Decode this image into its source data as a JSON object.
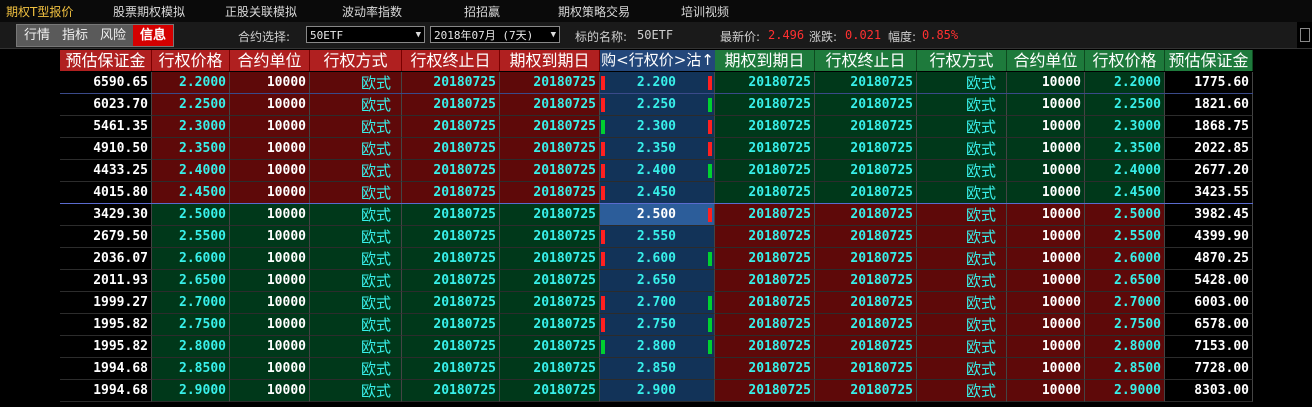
{
  "menu": [
    "期权T型报价",
    "股票期权模拟",
    "正股关联模拟",
    "波动率指数",
    "招招赢",
    "期权策略交易",
    "培训视频"
  ],
  "tabs": [
    {
      "label": "行情",
      "active": false
    },
    {
      "label": "指标",
      "active": false
    },
    {
      "label": "风险",
      "active": false
    },
    {
      "label": "信息",
      "active": true
    }
  ],
  "toolbar": {
    "contract_label": "合约选择:",
    "contract_value": "50ETF",
    "month_value": "2018年07月 (7天)",
    "underlying_label": "标的名称:",
    "underlying_value": "50ETF",
    "last_label": "最新价:",
    "last_value": "2.496",
    "change_label": "涨跌:",
    "change_value": "0.021",
    "pct_label": "幅度:",
    "pct_value": "0.85%"
  },
  "colors": {
    "call": "#b02020",
    "put": "#1e7a3c",
    "mid": "#23477a",
    "cyan": "#38f0ea",
    "up": "#ff3030"
  },
  "headers": {
    "call": [
      "预估保证金",
      "行权价格",
      "合约单位",
      "行权方式",
      "行权终止日",
      "期权到期日"
    ],
    "mid": "购<行权价>沽↑",
    "put": [
      "期权到期日",
      "行权终止日",
      "行权方式",
      "合约单位",
      "行权价格",
      "预估保证金"
    ]
  },
  "rows": [
    {
      "call_margin": "6590.65",
      "strike_call": "2.2000",
      "unit_call": "10000",
      "style_call": "欧式",
      "exercise_end_call": "20180725",
      "expiry_call": "20180725",
      "mid": "2.200",
      "ind_call": "red",
      "ind_put": "red",
      "expiry_put": "20180725",
      "exercise_end_put": "20180725",
      "style_put": "欧式",
      "unit_put": "10000",
      "strike_put": "2.2000",
      "put_margin": "1775.60"
    },
    {
      "call_margin": "6023.70",
      "strike_call": "2.2500",
      "unit_call": "10000",
      "style_call": "欧式",
      "exercise_end_call": "20180725",
      "expiry_call": "20180725",
      "mid": "2.250",
      "ind_call": "red",
      "ind_put": "green",
      "expiry_put": "20180725",
      "exercise_end_put": "20180725",
      "style_put": "欧式",
      "unit_put": "10000",
      "strike_put": "2.2500",
      "put_margin": "1821.60"
    },
    {
      "call_margin": "5461.35",
      "strike_call": "2.3000",
      "unit_call": "10000",
      "style_call": "欧式",
      "exercise_end_call": "20180725",
      "expiry_call": "20180725",
      "mid": "2.300",
      "ind_call": "green",
      "ind_put": "red",
      "expiry_put": "20180725",
      "exercise_end_put": "20180725",
      "style_put": "欧式",
      "unit_put": "10000",
      "strike_put": "2.3000",
      "put_margin": "1868.75"
    },
    {
      "call_margin": "4910.50",
      "strike_call": "2.3500",
      "unit_call": "10000",
      "style_call": "欧式",
      "exercise_end_call": "20180725",
      "expiry_call": "20180725",
      "mid": "2.350",
      "ind_call": "red",
      "ind_put": "red",
      "expiry_put": "20180725",
      "exercise_end_put": "20180725",
      "style_put": "欧式",
      "unit_put": "10000",
      "strike_put": "2.3500",
      "put_margin": "2022.85"
    },
    {
      "call_margin": "4433.25",
      "strike_call": "2.4000",
      "unit_call": "10000",
      "style_call": "欧式",
      "exercise_end_call": "20180725",
      "expiry_call": "20180725",
      "mid": "2.400",
      "ind_call": "red",
      "ind_put": "green",
      "expiry_put": "20180725",
      "exercise_end_put": "20180725",
      "style_put": "欧式",
      "unit_put": "10000",
      "strike_put": "2.4000",
      "put_margin": "2677.20"
    },
    {
      "call_margin": "4015.80",
      "strike_call": "2.4500",
      "unit_call": "10000",
      "style_call": "欧式",
      "exercise_end_call": "20180725",
      "expiry_call": "20180725",
      "mid": "2.450",
      "ind_call": "red",
      "ind_put": "none",
      "expiry_put": "20180725",
      "exercise_end_put": "20180725",
      "style_put": "欧式",
      "unit_put": "10000",
      "strike_put": "2.4500",
      "put_margin": "3423.55"
    },
    {
      "call_margin": "3429.30",
      "strike_call": "2.5000",
      "unit_call": "10000",
      "style_call": "欧式",
      "exercise_end_call": "20180725",
      "expiry_call": "20180725",
      "mid": "2.500",
      "ind_call": "none",
      "ind_put": "red",
      "expiry_put": "20180725",
      "exercise_end_put": "20180725",
      "style_put": "欧式",
      "unit_put": "10000",
      "strike_put": "2.5000",
      "put_margin": "3982.45"
    },
    {
      "call_margin": "2679.50",
      "strike_call": "2.5500",
      "unit_call": "10000",
      "style_call": "欧式",
      "exercise_end_call": "20180725",
      "expiry_call": "20180725",
      "mid": "2.550",
      "ind_call": "red",
      "ind_put": "none",
      "expiry_put": "20180725",
      "exercise_end_put": "20180725",
      "style_put": "欧式",
      "unit_put": "10000",
      "strike_put": "2.5500",
      "put_margin": "4399.90"
    },
    {
      "call_margin": "2036.07",
      "strike_call": "2.6000",
      "unit_call": "10000",
      "style_call": "欧式",
      "exercise_end_call": "20180725",
      "expiry_call": "20180725",
      "mid": "2.600",
      "ind_call": "red",
      "ind_put": "green",
      "expiry_put": "20180725",
      "exercise_end_put": "20180725",
      "style_put": "欧式",
      "unit_put": "10000",
      "strike_put": "2.6000",
      "put_margin": "4870.25"
    },
    {
      "call_margin": "2011.93",
      "strike_call": "2.6500",
      "unit_call": "10000",
      "style_call": "欧式",
      "exercise_end_call": "20180725",
      "expiry_call": "20180725",
      "mid": "2.650",
      "ind_call": "none",
      "ind_put": "none",
      "expiry_put": "20180725",
      "exercise_end_put": "20180725",
      "style_put": "欧式",
      "unit_put": "10000",
      "strike_put": "2.6500",
      "put_margin": "5428.00"
    },
    {
      "call_margin": "1999.27",
      "strike_call": "2.7000",
      "unit_call": "10000",
      "style_call": "欧式",
      "exercise_end_call": "20180725",
      "expiry_call": "20180725",
      "mid": "2.700",
      "ind_call": "red",
      "ind_put": "green",
      "expiry_put": "20180725",
      "exercise_end_put": "20180725",
      "style_put": "欧式",
      "unit_put": "10000",
      "strike_put": "2.7000",
      "put_margin": "6003.00"
    },
    {
      "call_margin": "1995.82",
      "strike_call": "2.7500",
      "unit_call": "10000",
      "style_call": "欧式",
      "exercise_end_call": "20180725",
      "expiry_call": "20180725",
      "mid": "2.750",
      "ind_call": "red",
      "ind_put": "green",
      "expiry_put": "20180725",
      "exercise_end_put": "20180725",
      "style_put": "欧式",
      "unit_put": "10000",
      "strike_put": "2.7500",
      "put_margin": "6578.00"
    },
    {
      "call_margin": "1995.82",
      "strike_call": "2.8000",
      "unit_call": "10000",
      "style_call": "欧式",
      "exercise_end_call": "20180725",
      "expiry_call": "20180725",
      "mid": "2.800",
      "ind_call": "green",
      "ind_put": "green",
      "expiry_put": "20180725",
      "exercise_end_put": "20180725",
      "style_put": "欧式",
      "unit_put": "10000",
      "strike_put": "2.8000",
      "put_margin": "7153.00"
    },
    {
      "call_margin": "1994.68",
      "strike_call": "2.8500",
      "unit_call": "10000",
      "style_call": "欧式",
      "exercise_end_call": "20180725",
      "expiry_call": "20180725",
      "mid": "2.850",
      "ind_call": "none",
      "ind_put": "none",
      "expiry_put": "20180725",
      "exercise_end_put": "20180725",
      "style_put": "欧式",
      "unit_put": "10000",
      "strike_put": "2.8500",
      "put_margin": "7728.00"
    },
    {
      "call_margin": "1994.68",
      "strike_call": "2.9000",
      "unit_call": "10000",
      "style_call": "欧式",
      "exercise_end_call": "20180725",
      "expiry_call": "20180725",
      "mid": "2.900",
      "ind_call": "none",
      "ind_put": "none",
      "expiry_put": "20180725",
      "exercise_end_put": "20180725",
      "style_put": "欧式",
      "unit_put": "10000",
      "strike_put": "2.9000",
      "put_margin": "8303.00"
    }
  ]
}
